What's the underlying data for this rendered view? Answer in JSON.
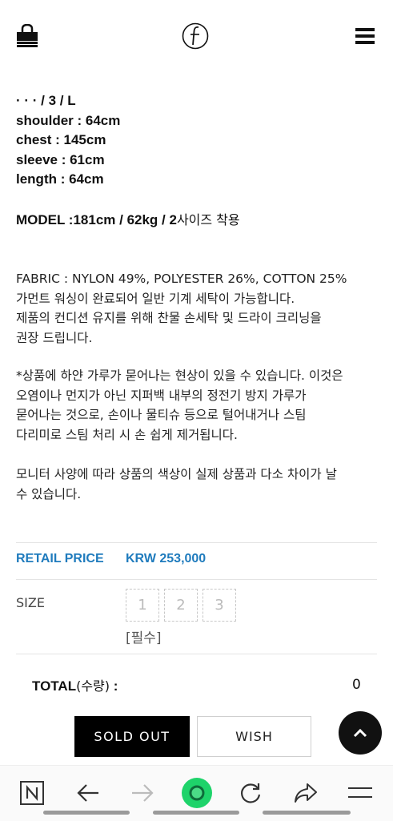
{
  "header": {
    "logo_alt": "f"
  },
  "specs": {
    "line0": "· · · / 3 / L",
    "shoulder": "shoulder : 64cm",
    "chest": "chest : 145cm",
    "sleeve": "sleeve : 61cm",
    "length": "length : 64cm"
  },
  "model": {
    "prefix": "MODEL :181cm / 62kg / 2",
    "suffix": "사이즈 착용"
  },
  "description": {
    "fabric": [
      "FABRIC : NYLON 49%, POLYESTER 26%, COTTON 25%",
      "가먼트 워싱이 완료되어 일반 기계 세탁이 가능합니다.",
      "제품의 컨디션 유지를 위해 찬물 손세탁 및 드라이 크리닝을",
      "권장 드립니다."
    ],
    "note": [
      "*상품에 하얀 가루가 묻어나는 현상이 있을 수 있습니다. 이것은",
      "오염이나 먼지가 아닌 지퍼백 내부의 정전기 방지 가루가",
      "묻어나는 것으로, 손이나 물티슈 등으로 털어내거나 스팀",
      "다리미로 스팀 처리 시 손 쉽게 제거됩니다."
    ],
    "monitor": [
      "모니터 사양에 따라 상품의 색상이 실제 상품과 다소 차이가 날",
      "수 있습니다."
    ]
  },
  "price": {
    "label": "RETAIL PRICE",
    "value": "KRW 253,000",
    "color": "#1f7bbd"
  },
  "size": {
    "label": "SIZE",
    "options": [
      "1",
      "2",
      "3"
    ],
    "required": "[필수]"
  },
  "total": {
    "label_en": "TOTAL",
    "label_ko": "(수량)",
    "label_colon": " :",
    "value": "0"
  },
  "buttons": {
    "sold_out": "SOLD OUT",
    "wish": "WISH"
  },
  "navbar": {
    "items": [
      "naver-n-icon",
      "back-arrow-icon",
      "forward-arrow-icon",
      "green-dot-icon",
      "refresh-icon",
      "share-icon",
      "menu-icon"
    ],
    "accent": "#1ed36a"
  }
}
